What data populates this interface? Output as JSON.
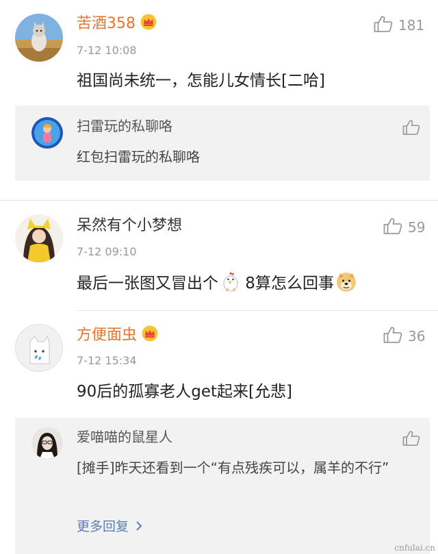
{
  "comments": [
    {
      "username": "苦酒358",
      "timestamp": "7-12 10:08",
      "content": "祖国尚未统一，怎能儿女情长[二哈]",
      "likes": "181",
      "vip": true,
      "reply": {
        "username": "扫雷玩的私聊咯",
        "text": "红包扫雷玩的私聊咯"
      }
    },
    {
      "username": "呆然有个小梦想",
      "timestamp": "7-12 09:10",
      "content_before": "最后一张图又冒出个",
      "content_after": " 8算怎么回事",
      "likes": "59",
      "vip": false
    },
    {
      "username": "方便面虫",
      "timestamp": "7-12 15:34",
      "content": "90后的孤寡老人get起来[允悲]",
      "likes": "36",
      "vip": true,
      "reply": {
        "username": "爱喵喵的鼠星人",
        "text": "[摊手]昨天还看到一个“有点残疾可以，属羊的不行”",
        "more_label": "更多回复"
      }
    }
  ],
  "watermark": "cnfulai.cn",
  "colors": {
    "vip_name": "#e8742c",
    "link": "#5b7fb5",
    "reply_bg": "#f2f2f2",
    "meta": "#999999"
  },
  "icons": [
    "thumbs-up-icon",
    "crown-icon",
    "chicken-emoji-icon",
    "doge-emoji-icon",
    "chevron-right-icon"
  ]
}
